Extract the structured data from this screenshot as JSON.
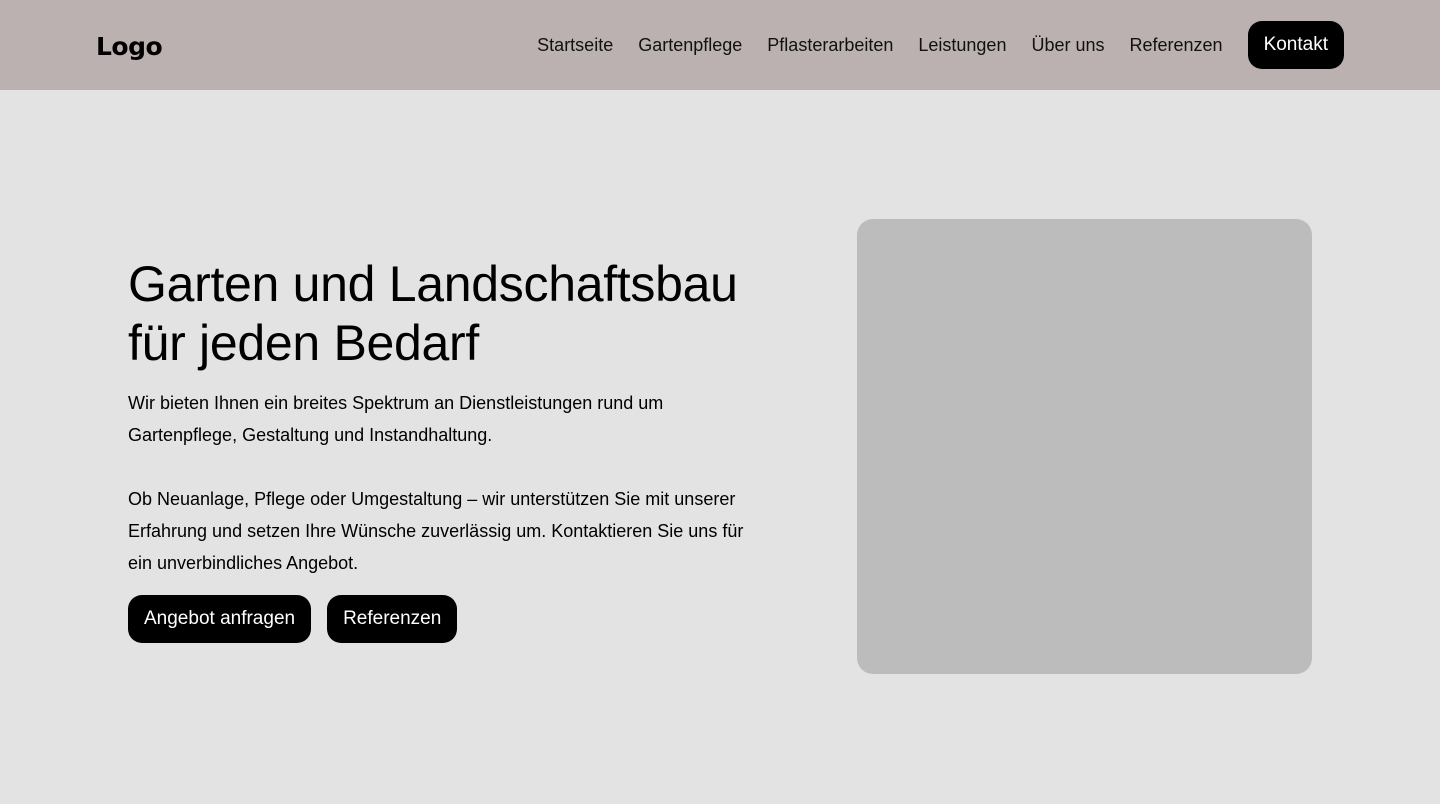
{
  "header": {
    "logo": "Logo",
    "nav": [
      {
        "label": "Startseite"
      },
      {
        "label": "Gartenpflege"
      },
      {
        "label": "Pflasterarbeiten"
      },
      {
        "label": "Leistungen"
      },
      {
        "label": "Über uns"
      },
      {
        "label": "Referenzen"
      }
    ],
    "cta_label": "Kontakt"
  },
  "hero": {
    "title_line1": "Garten und Landschaftsbau",
    "title_line2": "für jeden Bedarf",
    "paragraph1": "Wir bieten Ihnen ein breites Spektrum an Dienstleistungen rund um Gartenpflege, Gestaltung und Instandhaltung.",
    "paragraph2": "Ob Neuanlage, Pflege oder Umgestaltung – wir unterstützen Sie mit unserer Erfahrung und setzen Ihre Wünsche zuverlässig um. Kontaktieren Sie uns für ein unverbindliches Angebot.",
    "primary_button": "Angebot anfragen",
    "secondary_button": "Referenzen"
  },
  "colors": {
    "header_bg": "#bbb1b0",
    "page_bg": "#e3e3e3",
    "image_placeholder": "#bcbcbc",
    "button_bg": "#000000",
    "button_text": "#ffffff"
  }
}
